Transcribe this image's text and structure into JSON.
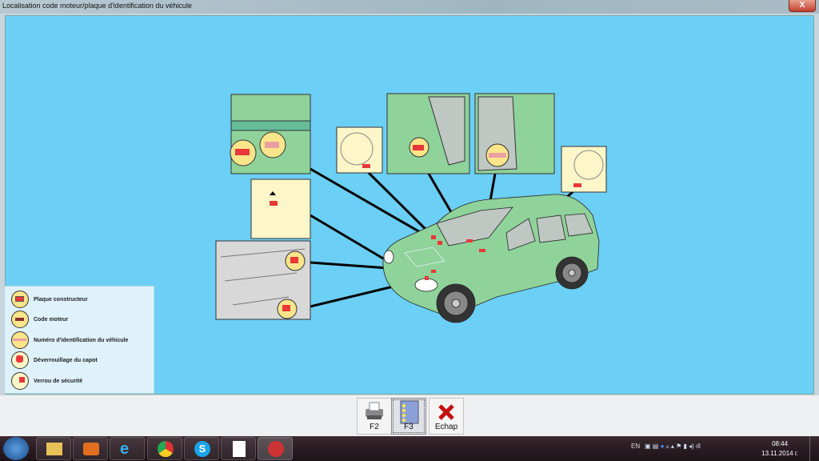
{
  "window": {
    "title": "Localisation code moteur/plaque d'identification du véhicule",
    "close_label": "X"
  },
  "legend": {
    "items": [
      {
        "label": "Plaque constructeur",
        "icon": "manufacturer-plate-icon"
      },
      {
        "label": "Code moteur",
        "icon": "engine-code-icon"
      },
      {
        "label": "Numéro d'identification du véhicule",
        "icon": "vin-icon"
      },
      {
        "label": "Déverrouillage du capot",
        "icon": "hood-release-icon"
      },
      {
        "label": "Verrou de sécurité",
        "icon": "safety-latch-icon"
      }
    ]
  },
  "toolbar": {
    "f2_label": "F2",
    "f3_label": "F3",
    "echap_label": "Echap"
  },
  "taskbar": {
    "lang": "EN",
    "time": "08:44",
    "date": "13.11.2014 г."
  },
  "colors": {
    "background": "#6ccff5",
    "car": "#8fd39a",
    "marker": "#e8383a"
  }
}
